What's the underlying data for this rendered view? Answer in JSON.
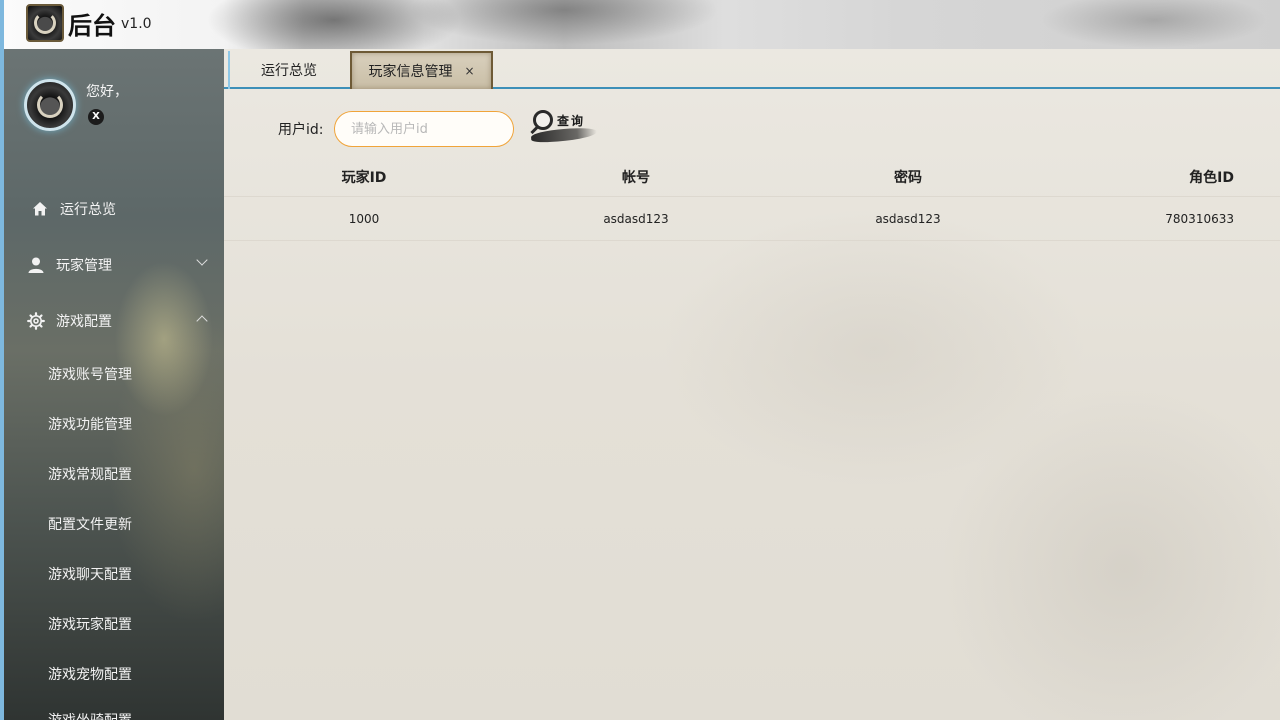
{
  "header": {
    "title": "后台",
    "version": "v1.0",
    "logo_icon": "game-emblem-icon"
  },
  "user": {
    "greeting": "您好，",
    "badge": "X"
  },
  "sidebar": {
    "items": [
      {
        "label": "运行总览",
        "icon": "home-icon"
      },
      {
        "label": "玩家管理",
        "icon": "user-icon",
        "expanded": false
      },
      {
        "label": "游戏配置",
        "icon": "gear-icon",
        "expanded": true
      }
    ],
    "subitems": [
      "游戏账号管理",
      "游戏功能管理",
      "游戏常规配置",
      "配置文件更新",
      "游戏聊天配置",
      "游戏玩家配置",
      "游戏宠物配置",
      "游戏坐骑配置"
    ]
  },
  "tabs": [
    {
      "label": "运行总览",
      "active": false
    },
    {
      "label": "玩家信息管理",
      "active": true,
      "close": "×"
    }
  ],
  "search": {
    "label": "用户id:",
    "placeholder": "请输入用户id",
    "value": "",
    "button_label": "查询"
  },
  "table": {
    "columns": [
      "玩家ID",
      "帐号",
      "密码",
      "角色ID"
    ],
    "rows": [
      [
        "1000",
        "asdasd123",
        "asdasd123",
        "780310633"
      ]
    ]
  },
  "colors": {
    "accent": "#3d8fb8",
    "input_border": "#f0a43a",
    "sidebar_edge": "#7eb8de"
  }
}
